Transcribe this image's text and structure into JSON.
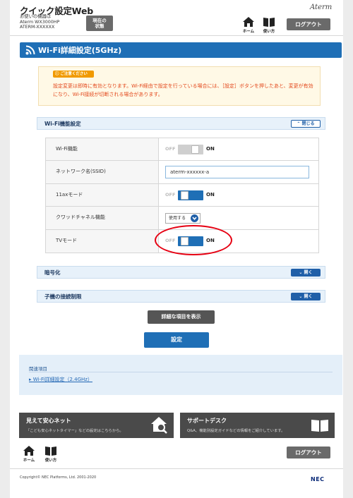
{
  "header": {
    "app_title": "クイック設定Web",
    "device_caption": "お使いの機器は",
    "device_model": "Aterm WX3000HP",
    "device_serial": "ATERM-XXXXXX",
    "status_button": "現在の\n状態",
    "brand": "Aterm",
    "home_label": "ホーム",
    "usage_label": "使い方",
    "logout_label": "ログアウト"
  },
  "page": {
    "title": "Wi-Fi詳細設定(5GHz)"
  },
  "notice": {
    "badge": "ご注意ください",
    "text": "設定変更は即時に有効となります。Wi-Fi経由で設定を行っている場合には、［設定］ボタンを押したあと、変更が有効になり、Wi-Fi接続が切断される場合があります。"
  },
  "wifi_function": {
    "header": "Wi-Fi機能設定",
    "collapse_label": "閉じる",
    "off_label": "OFF",
    "on_label": "ON",
    "rows": {
      "wifi": {
        "label": "Wi-Fi機能",
        "state": "off"
      },
      "ssid": {
        "label": "ネットワーク名(SSID)",
        "value": "aterm-xxxxxx-a"
      },
      "ax": {
        "label": "11axモード",
        "state": "on"
      },
      "quad": {
        "label": "クワッドチャネル機能",
        "value": "使用する"
      },
      "tv": {
        "label": "TVモード",
        "state": "on"
      }
    }
  },
  "encryption": {
    "header": "暗号化",
    "expand_label": "開く"
  },
  "client_limit": {
    "header": "子機の接続制限",
    "expand_label": "開く"
  },
  "actions": {
    "detail_button": "詳細な項目を表示",
    "save_button": "設定"
  },
  "related": {
    "heading": "関連項目",
    "link": "Wi-Fi詳細設定（2.4GHz）"
  },
  "banners": {
    "safety": {
      "title": "見えて安心ネット",
      "subtitle": "「こども安心ネットタイマー」などの設定はこちらから。"
    },
    "support": {
      "title": "サポートデスク",
      "subtitle": "Q&A、機能別設定ガイドなどの情報をご紹介しています。"
    }
  },
  "footer": {
    "home_label": "ホーム",
    "usage_label": "使い方",
    "logout_label": "ログアウト",
    "copyright": "Copyright© NEC Platforms, Ltd. 2001-2020",
    "logo": "NEC"
  },
  "colors": {
    "primary": "#1f6fb6",
    "notice_text": "#e3481c",
    "badge": "#f19a00",
    "highlight": "#e60012"
  },
  "icons": [
    "wifi-icon",
    "home-icon",
    "book-icon",
    "house-search-icon",
    "chevron-down-icon",
    "chevron-up-icon"
  ]
}
